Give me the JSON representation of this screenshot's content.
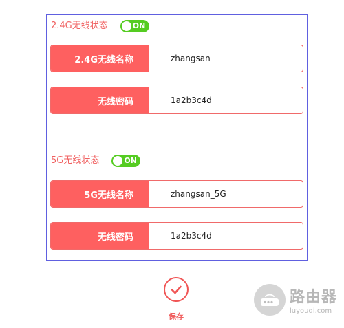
{
  "band_24g": {
    "status_label": "2.4G无线状态",
    "toggle_text": "ON",
    "name_label": "2.4G无线名称",
    "name_value": "zhangsan",
    "password_label": "无线密码",
    "password_value": "1a2b3c4d"
  },
  "band_5g": {
    "status_label": "5G无线状态",
    "toggle_text": "ON",
    "name_label": "5G无线名称",
    "name_value": "zhangsan_5G",
    "password_label": "无线密码",
    "password_value": "1a2b3c4d"
  },
  "save": {
    "label": "保存",
    "icon": "check-icon"
  },
  "watermark": {
    "title": "路由器",
    "subtitle": "luyouqi.com"
  },
  "colors": {
    "accent": "#fe6060",
    "toggle_on": "#55cc22",
    "panel_border": "#6060e0"
  }
}
